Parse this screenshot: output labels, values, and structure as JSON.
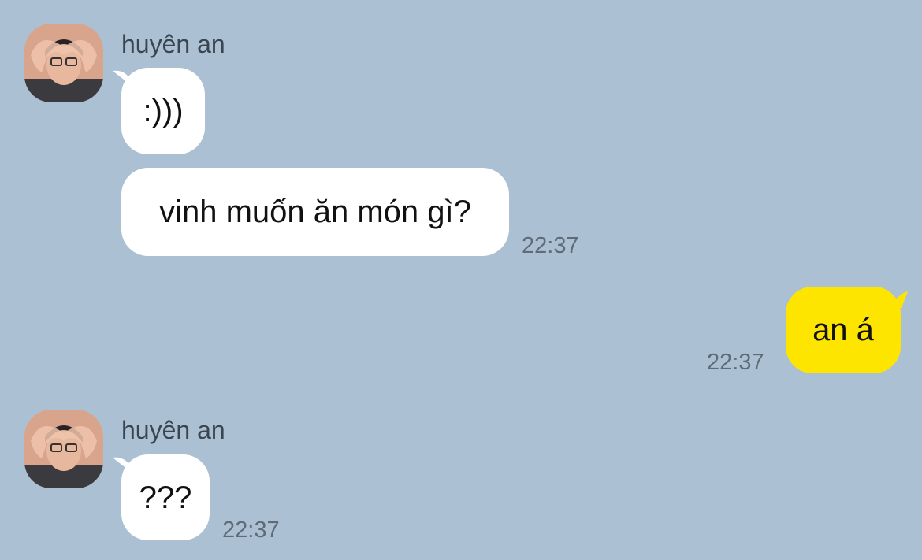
{
  "colors": {
    "background": "#abc1d3",
    "incoming_bubble": "#ffffff",
    "outgoing_bubble": "#fee500"
  },
  "messages": [
    {
      "sender": "huyên an",
      "avatar": "user-avatar",
      "bubbles": [
        ":)))",
        "vinh muốn ăn món gì?"
      ],
      "time": "22:37"
    },
    {
      "direction": "outgoing",
      "text": "an á",
      "time": "22:37"
    },
    {
      "sender": "huyên an",
      "avatar": "user-avatar",
      "bubbles": [
        "???"
      ],
      "time": "22:37"
    }
  ]
}
